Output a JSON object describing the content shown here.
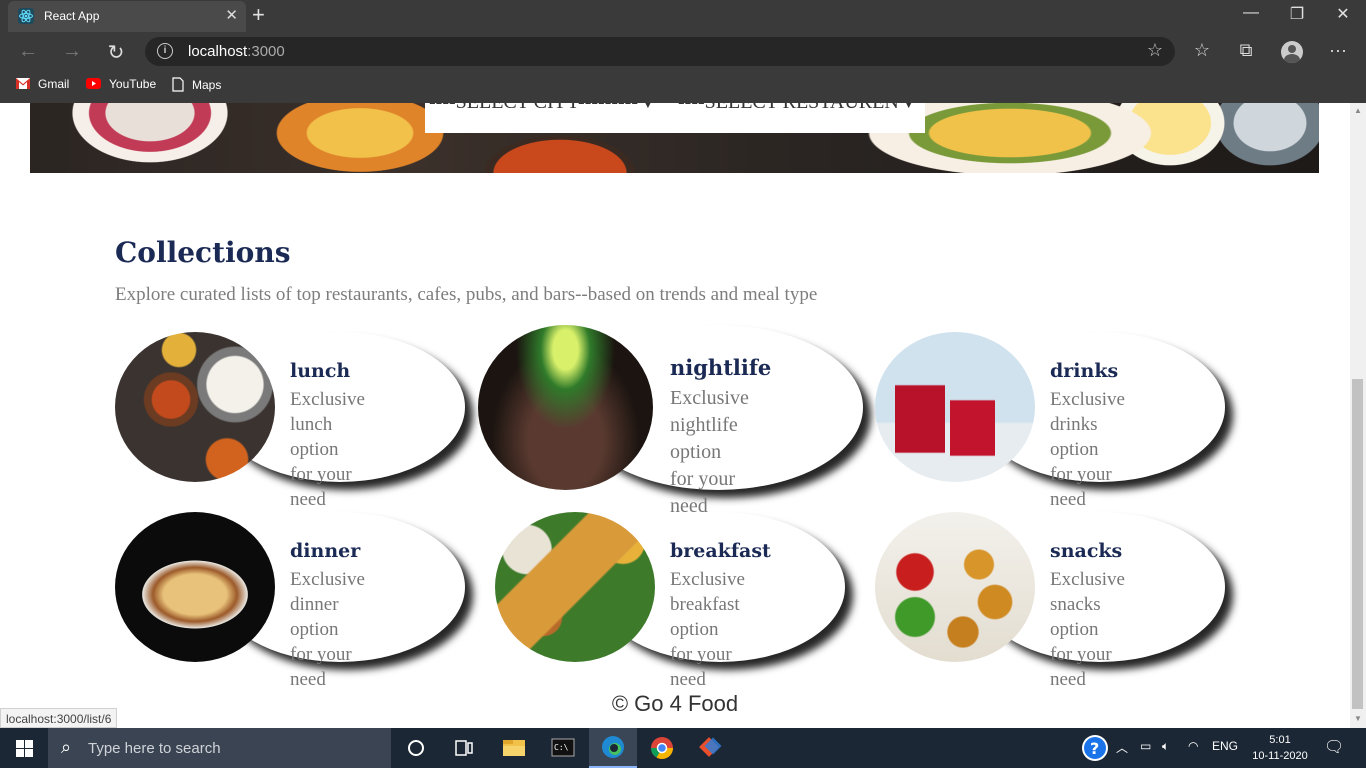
{
  "browser": {
    "tab_title": "React App",
    "url_host": "localhost",
    "url_port": ":3000",
    "bookmarks": [
      {
        "label": "Gmail"
      },
      {
        "label": "YouTube"
      },
      {
        "label": "Maps"
      }
    ],
    "status_url": "localhost:3000/list/6"
  },
  "page": {
    "city_select": "----SELECT CITY---------",
    "restaurant_select": "----SELECT RESTAUREN",
    "collections_title": "Collections",
    "collections_subtitle": "Explore curated lists of top restaurants, cafes, pubs, and bars--based on trends and meal type",
    "cards": [
      {
        "name": "lunch",
        "line1": "Exclusive lunch",
        "line2": "option for your need"
      },
      {
        "name": "nightlife",
        "line1": "Exclusive nightlife",
        "line2": "option for your need"
      },
      {
        "name": "drinks",
        "line1": "Exclusive drinks",
        "line2": "option for your need"
      },
      {
        "name": "dinner",
        "line1": "Exclusive dinner",
        "line2": "option for your need"
      },
      {
        "name": "breakfast",
        "line1": "Exclusive breakfast",
        "line2": "option for your need"
      },
      {
        "name": "snacks",
        "line1": "Exclusive snacks",
        "line2": "option for your need"
      }
    ],
    "footer": "© Go 4 Food"
  },
  "taskbar": {
    "search_placeholder": "Type here to search",
    "language": "ENG",
    "time": "5:01",
    "date": "10-11-2020"
  },
  "colors": {
    "heading": "#1b2a55",
    "muted_text": "#7d7d7d",
    "chrome_bg": "#3a3a3a",
    "taskbar_bg": "#1c2735"
  }
}
